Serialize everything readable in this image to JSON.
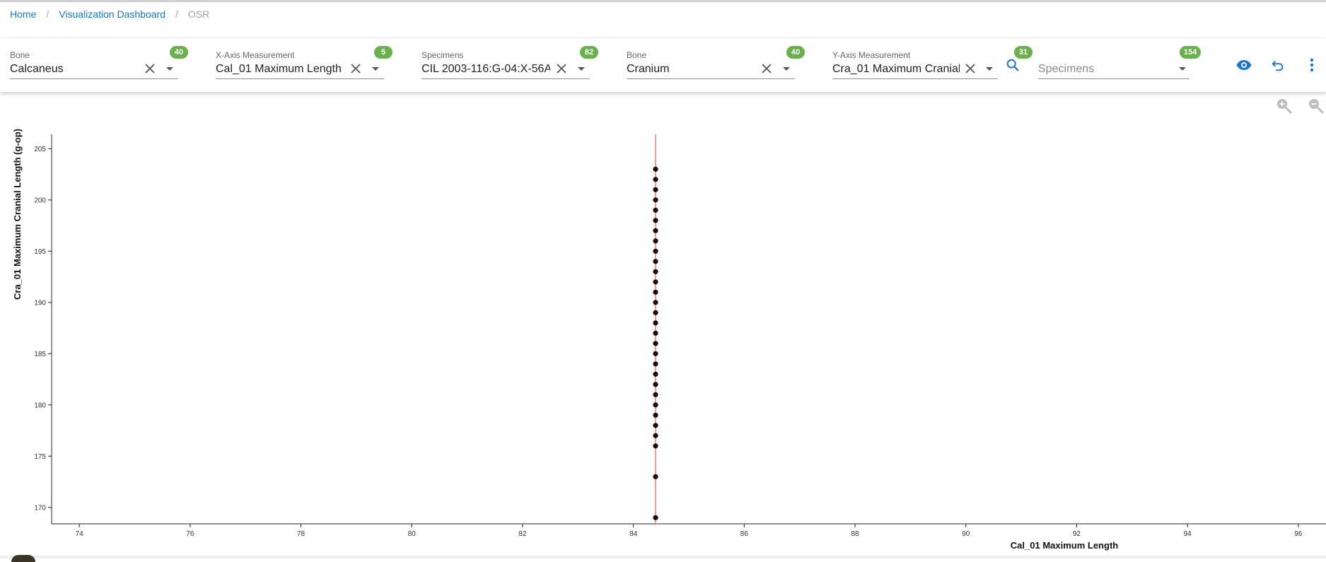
{
  "breadcrumb": {
    "home": "Home",
    "dashboard": "Visualization Dashboard",
    "current": "OSR",
    "separator": "/"
  },
  "filters": {
    "x_bone": {
      "label": "Bone",
      "value": "Calcaneus",
      "count": "40"
    },
    "x_measurement": {
      "label": "X-Axis Measurement",
      "value": "Cal_01 Maximum Length",
      "count": "5"
    },
    "x_specimens": {
      "label": "Specimens",
      "value": "CIL 2003-116:G-04:X-56A:",
      "count": "82"
    },
    "y_bone": {
      "label": "Bone",
      "value": "Cranium",
      "count": "40"
    },
    "y_measurement": {
      "label": "Y-Axis Measurement",
      "value": "Cra_01 Maximum Cranial",
      "count": "31"
    },
    "y_specimens": {
      "placeholder": "Specimens",
      "count": "154"
    }
  },
  "actions": {
    "view_icon": "eye-icon",
    "undo_icon": "undo-icon",
    "more_icon": "more-vert-icon",
    "search_icon": "search-icon"
  },
  "colors": {
    "accent": "#1976d2",
    "badge": "#6ab04c",
    "regression_line": "#e8806f",
    "point": "#1a0a0a"
  },
  "chart_data": {
    "type": "scatter",
    "xlabel": "Cal_01 Maximum Length",
    "ylabel": "Cra_01 Maximum Cranial Length (g-op)",
    "xlim": [
      73.5,
      96.5
    ],
    "ylim": [
      168.4,
      206.4
    ],
    "x_ticks": [
      74,
      76,
      78,
      80,
      82,
      84,
      86,
      88,
      90,
      92,
      94,
      96
    ],
    "y_ticks": [
      170,
      175,
      180,
      185,
      190,
      195,
      200,
      205
    ],
    "vertical_line_x": 84.4,
    "points": [
      {
        "x": 84.4,
        "y": 169
      },
      {
        "x": 84.4,
        "y": 173
      },
      {
        "x": 84.4,
        "y": 176
      },
      {
        "x": 84.4,
        "y": 177
      },
      {
        "x": 84.4,
        "y": 178
      },
      {
        "x": 84.4,
        "y": 179
      },
      {
        "x": 84.4,
        "y": 180
      },
      {
        "x": 84.4,
        "y": 181
      },
      {
        "x": 84.4,
        "y": 182
      },
      {
        "x": 84.4,
        "y": 183
      },
      {
        "x": 84.4,
        "y": 184
      },
      {
        "x": 84.4,
        "y": 185
      },
      {
        "x": 84.4,
        "y": 186
      },
      {
        "x": 84.4,
        "y": 187
      },
      {
        "x": 84.4,
        "y": 188
      },
      {
        "x": 84.4,
        "y": 189
      },
      {
        "x": 84.4,
        "y": 190
      },
      {
        "x": 84.4,
        "y": 191
      },
      {
        "x": 84.4,
        "y": 192
      },
      {
        "x": 84.4,
        "y": 193
      },
      {
        "x": 84.4,
        "y": 194
      },
      {
        "x": 84.4,
        "y": 195
      },
      {
        "x": 84.4,
        "y": 196
      },
      {
        "x": 84.4,
        "y": 197
      },
      {
        "x": 84.4,
        "y": 198
      },
      {
        "x": 84.4,
        "y": 199
      },
      {
        "x": 84.4,
        "y": 200
      },
      {
        "x": 84.4,
        "y": 201
      },
      {
        "x": 84.4,
        "y": 202
      },
      {
        "x": 84.4,
        "y": 203
      }
    ],
    "grid": false,
    "legend": "none"
  }
}
